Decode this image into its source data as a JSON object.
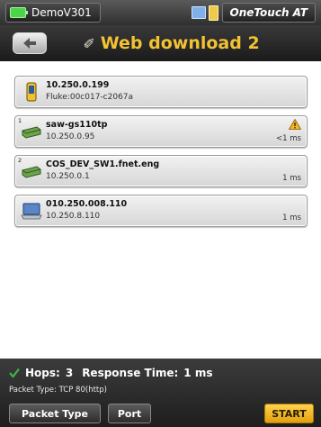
{
  "status": {
    "device": "DemoV301",
    "brand": "OneTouch AT"
  },
  "title": {
    "text": "Web download 2",
    "icon": "web-download-icon"
  },
  "hops": [
    {
      "hop_label": "",
      "name": "10.250.0.199",
      "sub": "Fluke:00c017-c2067a",
      "time": "",
      "icon": "tester-icon",
      "warning": false
    },
    {
      "hop_label": "1",
      "name": "saw-gs110tp",
      "sub": "10.250.0.95",
      "time": "<1 ms",
      "icon": "switch-icon",
      "warning": true
    },
    {
      "hop_label": "2",
      "name": "COS_DEV_SW1.fnet.eng",
      "sub": "10.250.0.1",
      "time": "1 ms",
      "icon": "switch-icon",
      "warning": false
    },
    {
      "hop_label": "",
      "name": "010.250.008.110",
      "sub": "10.250.8.110",
      "time": "1 ms",
      "icon": "computer-icon",
      "warning": false
    }
  ],
  "summary": {
    "hops_label": "Hops:",
    "hops_value": "3",
    "response_label": "Response Time:",
    "response_value": "1 ms",
    "packet_type": "Packet Type: TCP 80(http)"
  },
  "buttons": {
    "packet_type": "Packet Type",
    "port": "Port",
    "start": "START"
  },
  "colors": {
    "accent": "#f2c234",
    "start": "#f5b623",
    "ok": "#3fb24a"
  }
}
